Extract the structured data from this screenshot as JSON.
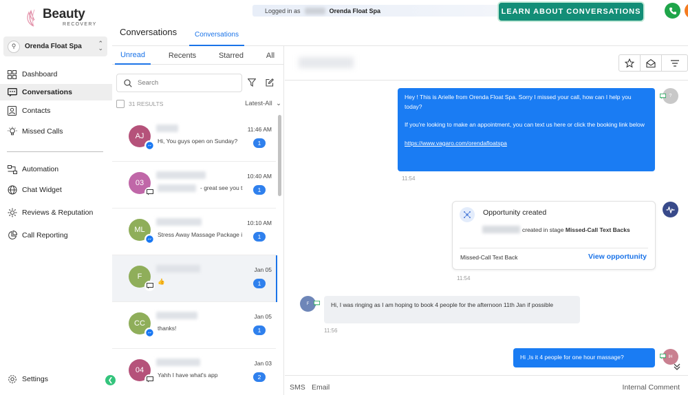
{
  "brand": {
    "name": "Beauty",
    "sub": "RECOVERY"
  },
  "account": {
    "name": "Orenda Float Spa"
  },
  "nav": {
    "dashboard": "Dashboard",
    "conversations": "Conversations",
    "contacts": "Contacts",
    "missed_calls": "Missed Calls",
    "automation": "Automation",
    "chat_widget": "Chat Widget",
    "reviews": "Reviews & Reputation",
    "call_reporting": "Call Reporting",
    "settings": "Settings"
  },
  "topbar": {
    "logged_in_prefix": "Logged in as",
    "logged_in_account": "Orenda Float Spa",
    "learn_button": "LEARN ABOUT CONVERSATIONS",
    "page_title": "Conversations",
    "active_tab": "Conversations"
  },
  "list": {
    "tabs": [
      "Unread",
      "Recents",
      "Starred",
      "All"
    ],
    "search_placeholder": "Search",
    "results": "31 RESULTS",
    "sort": "Latest-All",
    "items": [
      {
        "initials": "AJ",
        "color": "#b5527a",
        "channel": "messenger",
        "preview": "Hi, You guys open on Sunday?",
        "time": "11:46 AM",
        "count": "1"
      },
      {
        "initials": "03",
        "color": "#c067a8",
        "channel": "sms",
        "preview": "- great see you t",
        "time": "10:40 AM",
        "count": "1"
      },
      {
        "initials": "ML",
        "color": "#8fae5a",
        "channel": "messenger",
        "preview": "Stress Away Massage Package i",
        "time": "10:10 AM",
        "count": "1"
      },
      {
        "initials": "F",
        "color": "#8fae5a",
        "channel": "sms",
        "preview": "👍",
        "time": "Jan 05",
        "count": "1"
      },
      {
        "initials": "CC",
        "color": "#8fae5a",
        "channel": "messenger",
        "preview": "thanks!",
        "time": "Jan 05",
        "count": "1"
      },
      {
        "initials": "04",
        "color": "#b5527a",
        "channel": "sms",
        "preview": "Yahh I have what's app",
        "time": "Jan 03",
        "count": "2"
      }
    ]
  },
  "chat": {
    "messages": {
      "m1_line1": "Hey ! This is Arielle from Orenda Float Spa. Sorry I missed your call, how can I help you today?",
      "m1_line2": "If you're looking to make an appointment, you can text us here or click the booking link below",
      "m1_link": "https://www.vagaro.com/orendafloatspa",
      "m1_time": "11:54",
      "m1_avatar": "?",
      "opp_title": "Opportunity created",
      "opp_desc_mid": "created in stage",
      "opp_stage_bold": "Missed-Call Text Backs",
      "opp_stage": "Missed-Call Text Back",
      "opp_link": "View opportunity",
      "opp_time": "11:54",
      "m2_text": "Hi, I was ringing as I am hoping to book 4 people for the afternoon 11th Jan if possible",
      "m2_time": "11:56",
      "m2_avatar": "F",
      "m3_text": "Hi ,Is it 4 people for one hour massage?",
      "m3_avatar": "IH"
    },
    "compose_tabs": [
      "SMS",
      "Email"
    ],
    "internal_comment": "Internal Comment"
  },
  "colors": {
    "accent": "#1a73e8",
    "brand_green": "#138e77",
    "bubble_out": "#1a7cf3"
  }
}
